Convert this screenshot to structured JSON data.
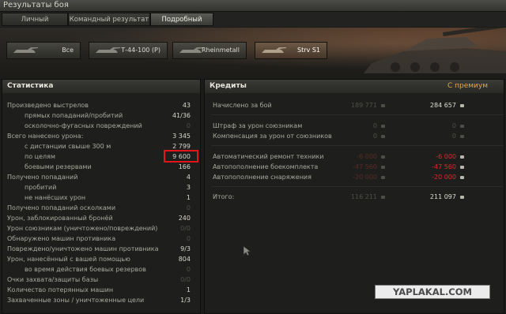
{
  "window": {
    "title": "Результаты боя"
  },
  "tabs": [
    {
      "label": "Личный результат"
    },
    {
      "label": "Командный результат"
    },
    {
      "label": "Подробный отчёт"
    }
  ],
  "vehicle_buttons": [
    {
      "label": "Все"
    },
    {
      "label": "Т-44-100 (Р)"
    },
    {
      "label": "Rheinmetall"
    },
    {
      "label": "Strv S1"
    }
  ],
  "stats": {
    "header": "Статистика",
    "rows": [
      {
        "label": "Произведено выстрелов",
        "value": "43"
      },
      {
        "label": "прямых попаданий/пробитий",
        "value": "41/36"
      },
      {
        "label": "осколочно-фугасных повреждений",
        "value": "0"
      },
      {
        "label": "Всего нанесено урона:",
        "value": "3 345"
      },
      {
        "label": "с дистанции свыше 300 м",
        "value": "2 799"
      },
      {
        "label": "по целям",
        "value": "9 600"
      },
      {
        "label": "боевыми резервами",
        "value": "166"
      },
      {
        "label": "Получено попаданий",
        "value": "4"
      },
      {
        "label": "пробитий",
        "value": "3"
      },
      {
        "label": "не нанёсших урон",
        "value": "1"
      },
      {
        "label": "Получено попаданий осколками",
        "value": "0"
      },
      {
        "label": "Урон, заблокированный бронёй",
        "value": "240"
      },
      {
        "label": "Урон союзникам (уничтожено/повреждений)",
        "value": "0/0"
      },
      {
        "label": "Обнаружено машин противника",
        "value": "0"
      },
      {
        "label": "Повреждено/уничтожено машин противника",
        "value": "9/3"
      },
      {
        "label": "Урон, нанесённый с вашей помощью",
        "value": "804"
      },
      {
        "label": "во время действия боевых резервов",
        "value": "0"
      },
      {
        "label": "Очки захвата/защиты базы",
        "value": "0/0"
      },
      {
        "label": "Количество потерянных машин",
        "value": "1"
      },
      {
        "label": "Захваченные зоны / уничтоженные цели",
        "value": "1/3"
      }
    ]
  },
  "credits": {
    "header": "Кредиты",
    "premium_header": "С премиум",
    "rows": [
      {
        "label": "Начислено за бой",
        "base": "189 771",
        "premium": "284 657"
      },
      {
        "label": "Штраф за урон союзникам",
        "base": "0",
        "premium": "0"
      },
      {
        "label": "Компенсация за урон от союзников",
        "base": "0",
        "premium": "0"
      },
      {
        "label": "Автоматический ремонт техники",
        "base": "-6 000",
        "premium": "-6 000"
      },
      {
        "label": "Автопополнение боекомплекта",
        "base": "-47 560",
        "premium": "-47 560"
      },
      {
        "label": "Автопополнение снаряжения",
        "base": "-20 000",
        "premium": "-20 000"
      },
      {
        "label": "Итого:",
        "base": "116 211",
        "premium": "211 097"
      }
    ]
  },
  "watermark": "YAPLAKAL.COM",
  "colors": {
    "premium": "#e8a64a",
    "negative": "#e0262b",
    "highlight": "#e3141a"
  }
}
